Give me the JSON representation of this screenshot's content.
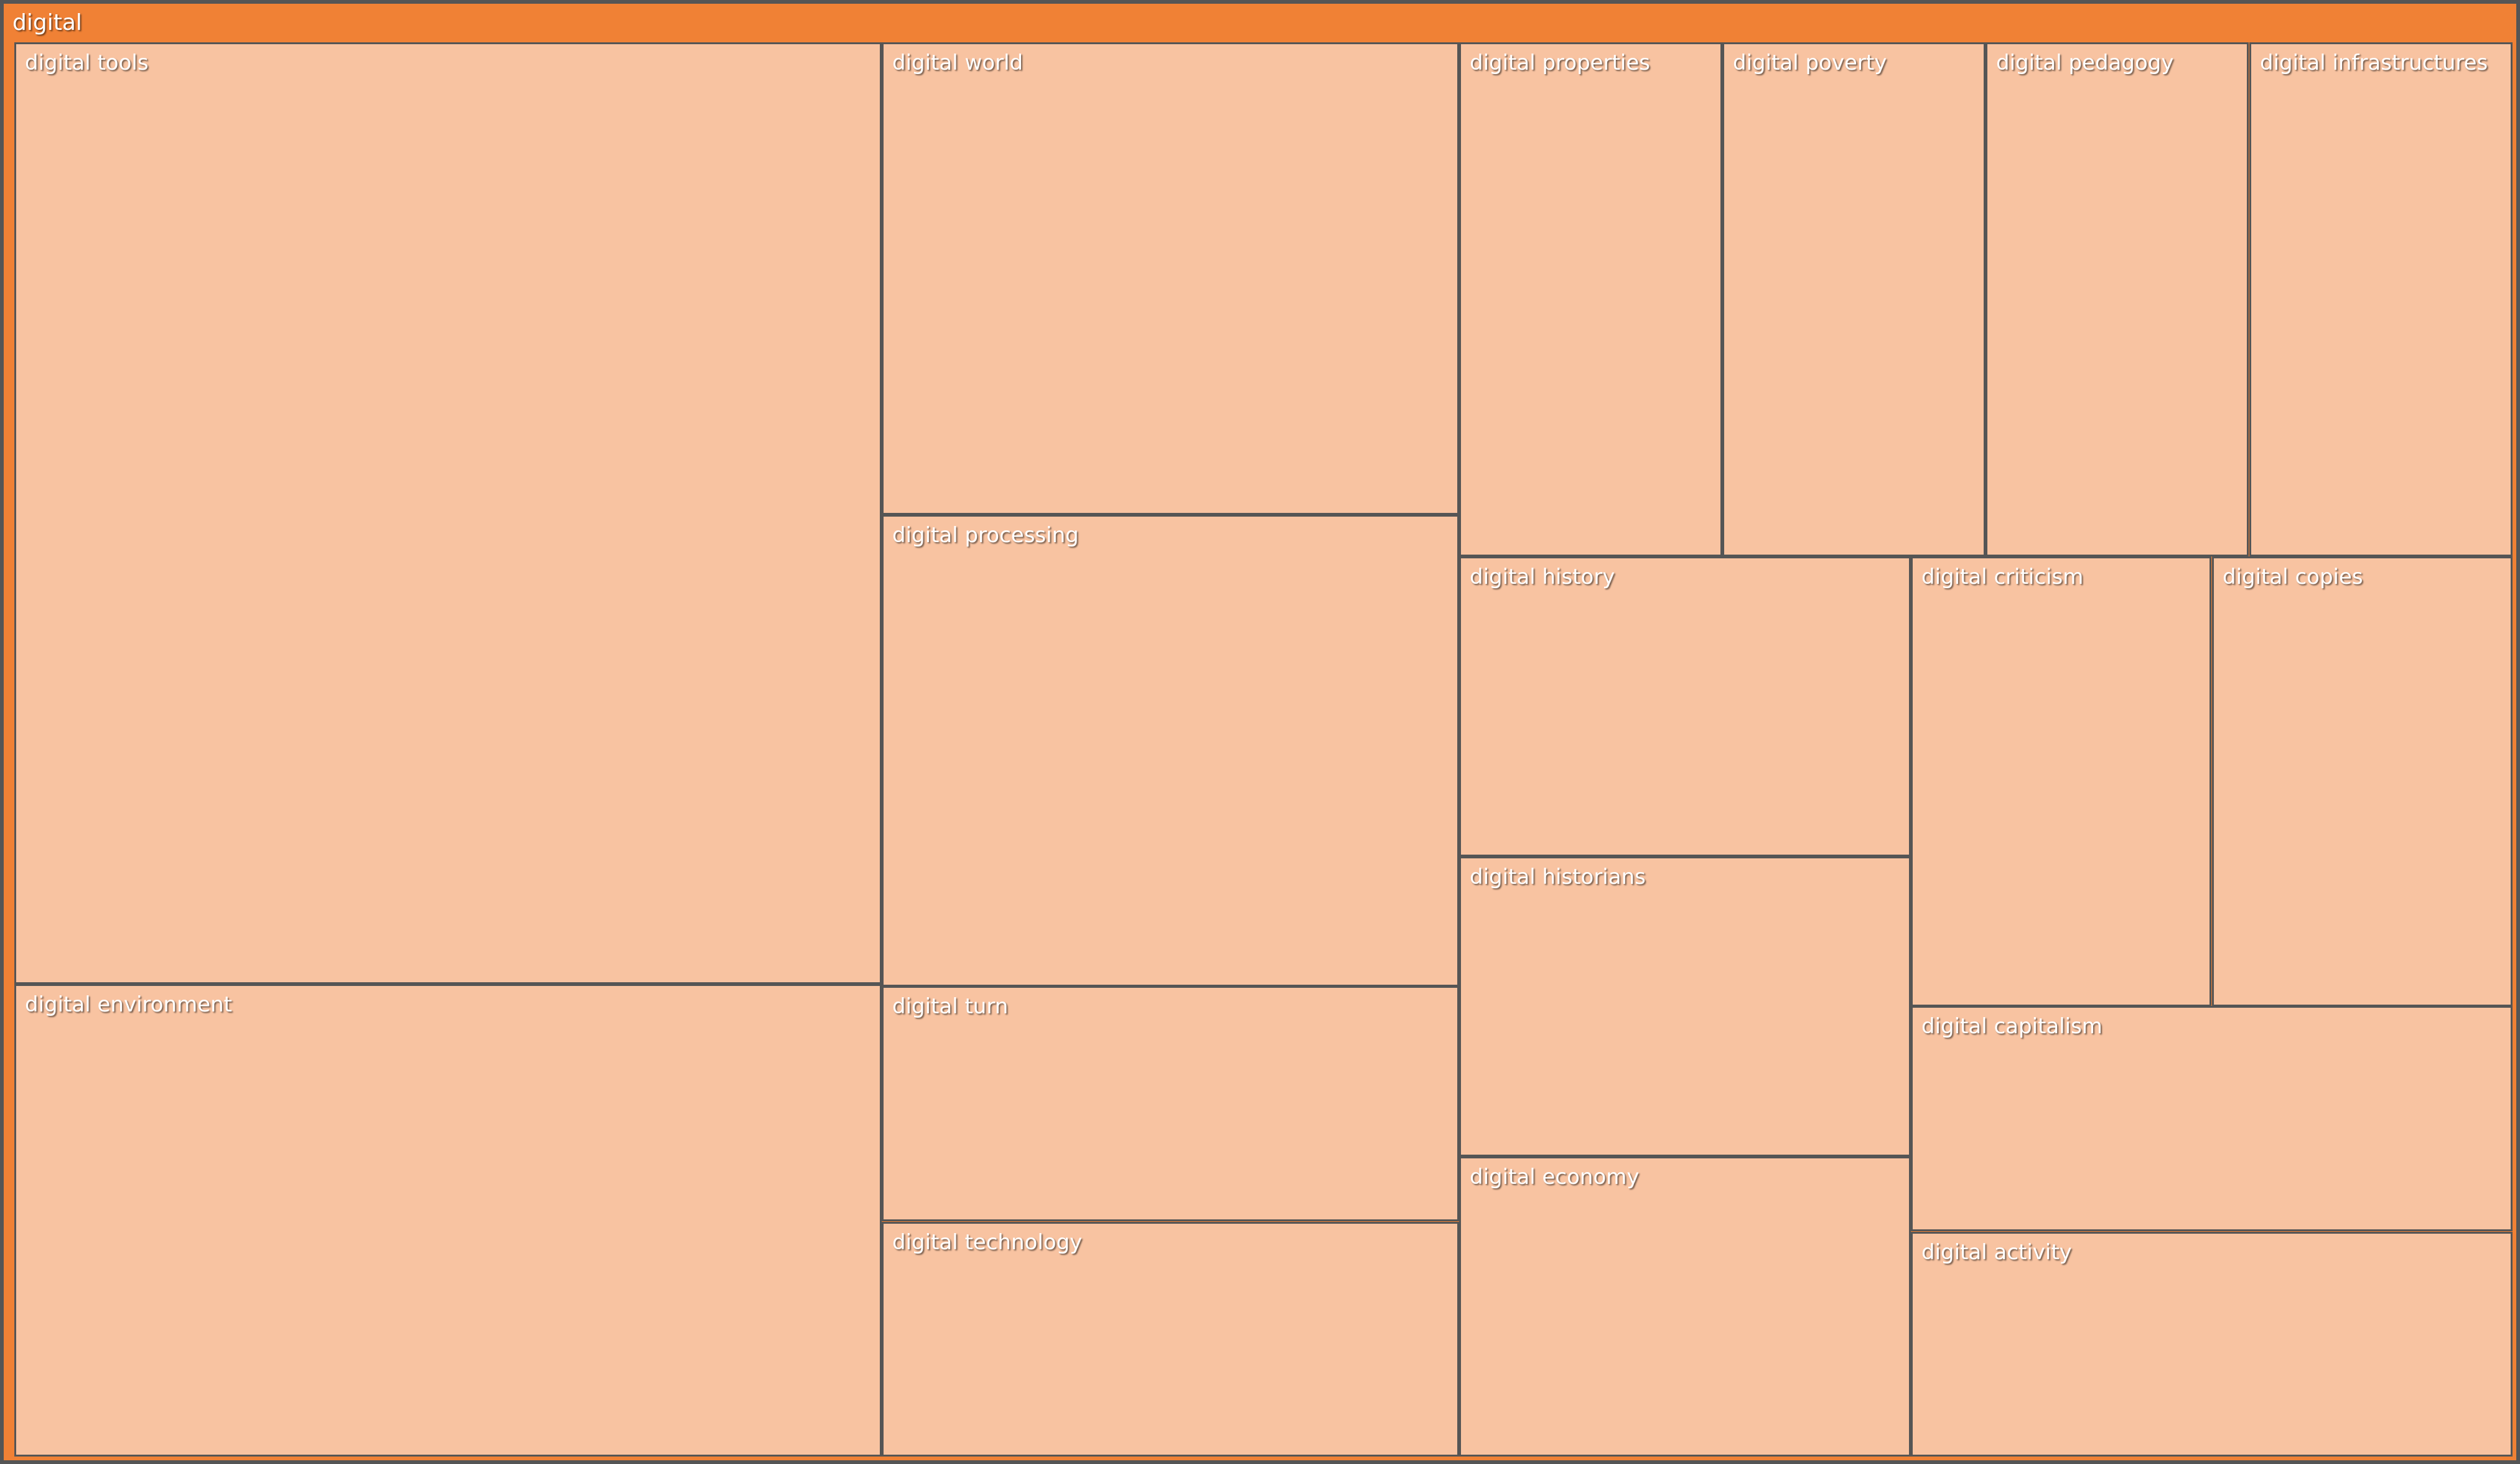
{
  "chart_data": {
    "type": "treemap",
    "root": "digital",
    "colors": {
      "root": "#f08135",
      "cell": "#f8c3a1",
      "border": "#555555",
      "label": "#ffffff"
    },
    "items": [
      {
        "label": "digital tools",
        "value": 3151
      },
      {
        "label": "digital environment",
        "value": 1580
      },
      {
        "label": "digital world",
        "value": 1051
      },
      {
        "label": "digital processing",
        "value": 1050
      },
      {
        "label": "digital turn",
        "value": 524
      },
      {
        "label": "digital technology",
        "value": 523
      },
      {
        "label": "digital properties",
        "value": 522
      },
      {
        "label": "digital poverty",
        "value": 522
      },
      {
        "label": "digital pedagogy",
        "value": 522
      },
      {
        "label": "digital infrastructures",
        "value": 522
      },
      {
        "label": "digital history",
        "value": 523
      },
      {
        "label": "digital historians",
        "value": 523
      },
      {
        "label": "digital economy",
        "value": 523
      },
      {
        "label": "digital criticism",
        "value": 522
      },
      {
        "label": "digital copies",
        "value": 522
      },
      {
        "label": "digital capitalism",
        "value": 523
      },
      {
        "label": "digital activity",
        "value": 522
      }
    ]
  }
}
